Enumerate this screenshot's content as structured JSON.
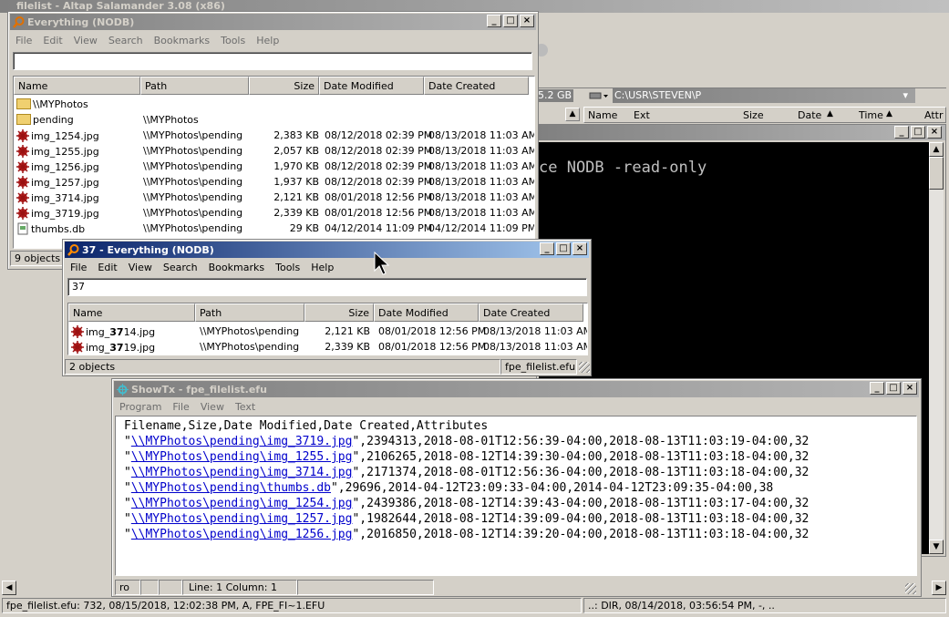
{
  "salamander": {
    "title": "filelist - Altap Salamander 3.08 (x86)",
    "drive_size": "5.2 GB",
    "path": "C:\\USR\\STEVEN\\P",
    "columns": [
      "Name",
      "Ext",
      "Size",
      "Date",
      "Time",
      "Attr"
    ],
    "status_left": "fpe_filelist.efu: 732, 08/15/2018, 12:02:38 PM, A, FPE_FI~1.EFU",
    "status_right": "..: DIR, 08/14/2018, 03:56:54 PM, -, ..",
    "console_text": "ce NODB -read-only"
  },
  "everything1": {
    "title": "Everything (NODB)",
    "menu": [
      "File",
      "Edit",
      "View",
      "Search",
      "Bookmarks",
      "Tools",
      "Help"
    ],
    "search_value": "",
    "columns": [
      "Name",
      "Path",
      "Size",
      "Date Modified",
      "Date Created"
    ],
    "rows": [
      {
        "name": "\\\\MYPhotos",
        "path": "",
        "size": "",
        "modified": "",
        "created": "",
        "type": "folder"
      },
      {
        "name": "pending",
        "path": "\\\\MYPhotos",
        "size": "",
        "modified": "",
        "created": "",
        "type": "folder"
      },
      {
        "name": "img_1254.jpg",
        "path": "\\\\MYPhotos\\pending",
        "size": "2,383 KB",
        "modified": "08/12/2018 02:39 PM",
        "created": "08/13/2018 11:03 AM",
        "type": "jpg"
      },
      {
        "name": "img_1255.jpg",
        "path": "\\\\MYPhotos\\pending",
        "size": "2,057 KB",
        "modified": "08/12/2018 02:39 PM",
        "created": "08/13/2018 11:03 AM",
        "type": "jpg"
      },
      {
        "name": "img_1256.jpg",
        "path": "\\\\MYPhotos\\pending",
        "size": "1,970 KB",
        "modified": "08/12/2018 02:39 PM",
        "created": "08/13/2018 11:03 AM",
        "type": "jpg"
      },
      {
        "name": "img_1257.jpg",
        "path": "\\\\MYPhotos\\pending",
        "size": "1,937 KB",
        "modified": "08/12/2018 02:39 PM",
        "created": "08/13/2018 11:03 AM",
        "type": "jpg"
      },
      {
        "name": "img_3714.jpg",
        "path": "\\\\MYPhotos\\pending",
        "size": "2,121 KB",
        "modified": "08/01/2018 12:56 PM",
        "created": "08/13/2018 11:03 AM",
        "type": "jpg"
      },
      {
        "name": "img_3719.jpg",
        "path": "\\\\MYPhotos\\pending",
        "size": "2,339 KB",
        "modified": "08/01/2018 12:56 PM",
        "created": "08/13/2018 11:03 AM",
        "type": "jpg"
      },
      {
        "name": "thumbs.db",
        "path": "\\\\MYPhotos\\pending",
        "size": "29 KB",
        "modified": "04/12/2014 11:09 PM",
        "created": "04/12/2014 11:09 PM",
        "type": "db"
      }
    ],
    "status": "9 objects"
  },
  "everything2": {
    "title": "37 - Everything (NODB)",
    "menu": [
      "File",
      "Edit",
      "View",
      "Search",
      "Bookmarks",
      "Tools",
      "Help"
    ],
    "search_value": "37",
    "columns": [
      "Name",
      "Path",
      "Size",
      "Date Modified",
      "Date Created"
    ],
    "rows": [
      {
        "name_pre": "img_",
        "name_bold": "37",
        "name_post": "14.jpg",
        "path": "\\\\MYPhotos\\pending",
        "size": "2,121 KB",
        "modified": "08/01/2018 12:56 PM",
        "created": "08/13/2018 11:03 AM"
      },
      {
        "name_pre": "img_",
        "name_bold": "37",
        "name_post": "19.jpg",
        "path": "\\\\MYPhotos\\pending",
        "size": "2,339 KB",
        "modified": "08/01/2018 12:56 PM",
        "created": "08/13/2018 11:03 AM"
      }
    ],
    "status": "2 objects",
    "filelist": "fpe_filelist.efu"
  },
  "showtx": {
    "title": "ShowTx - fpe_filelist.efu",
    "menu": [
      "Program",
      "File",
      "View",
      "Text"
    ],
    "header_line": "Filename,Size,Date Modified,Date Created,Attributes",
    "lines": [
      {
        "link": "\\\\MYPhotos\\pending\\img_3719.jpg",
        "rest": "\",2394313,2018-08-01T12:56:39-04:00,2018-08-13T11:03:19-04:00,32"
      },
      {
        "link": "\\\\MYPhotos\\pending\\img_1255.jpg",
        "rest": "\",2106265,2018-08-12T14:39:30-04:00,2018-08-13T11:03:18-04:00,32"
      },
      {
        "link": "\\\\MYPhotos\\pending\\img_3714.jpg",
        "rest": "\",2171374,2018-08-01T12:56:36-04:00,2018-08-13T11:03:18-04:00,32"
      },
      {
        "link": "\\\\MYPhotos\\pending\\thumbs.db",
        "rest": "\",29696,2014-04-12T23:09:33-04:00,2014-04-12T23:09:35-04:00,38"
      },
      {
        "link": "\\\\MYPhotos\\pending\\img_1254.jpg",
        "rest": "\",2439386,2018-08-12T14:39:43-04:00,2018-08-13T11:03:17-04:00,32"
      },
      {
        "link": "\\\\MYPhotos\\pending\\img_1257.jpg",
        "rest": "\",1982644,2018-08-12T14:39:09-04:00,2018-08-13T11:03:18-04:00,32"
      },
      {
        "link": "\\\\MYPhotos\\pending\\img_1256.jpg",
        "rest": "\",2016850,2018-08-12T14:39:20-04:00,2018-08-13T11:03:18-04:00,32"
      }
    ],
    "status_mode": "ro",
    "status_pos": "Line: 1 Column: 1"
  }
}
